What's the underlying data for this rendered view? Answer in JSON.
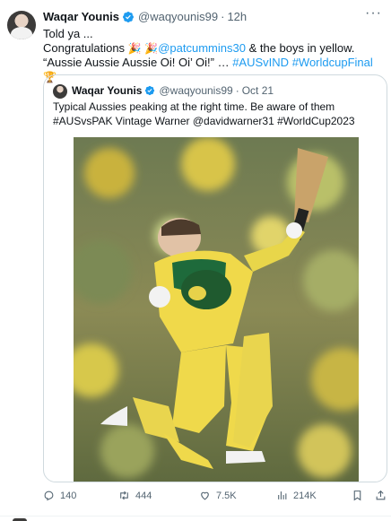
{
  "tweet": {
    "name": "Waqar Younis",
    "handle": "@waqyounis99",
    "time": "12h",
    "line1": "Told ya ...",
    "text_pre": "Congratulations ",
    "mention": "@patcummins30",
    "text_mid": " & the boys in yellow. “Aussie Aussie Aussie Oi! Oi’ Oi!” … ",
    "hashtag1": "#AUSvIND",
    "hashtag2": "#WorldcupFinal",
    "emoji_party": "🎉",
    "emoji_trophy": "🏆"
  },
  "quote": {
    "name": "Waqar Younis",
    "handle": "@waqyounis99",
    "date": "Oct 21",
    "text": "Typical Aussies peaking at the right time. Be aware of them #AUSvsPAK Vintage Warner @davidwarner31 #WorldCup2023"
  },
  "actions": {
    "replies": "140",
    "reposts": "444",
    "likes": "7.5K",
    "views": "214K"
  },
  "colors": {
    "link": "#1d9bf0",
    "muted": "#536471",
    "border": "#cfd9de",
    "verified": "#1d9bf0"
  },
  "icons": [
    "more-icon",
    "verified-icon",
    "reply-icon",
    "repost-icon",
    "like-icon",
    "views-icon",
    "bookmark-icon",
    "share-icon"
  ]
}
